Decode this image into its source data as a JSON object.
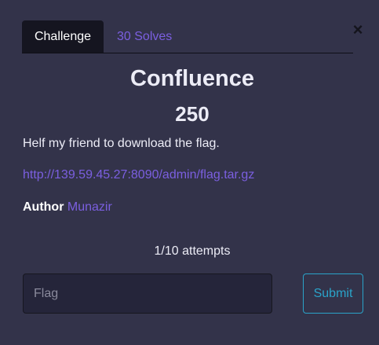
{
  "close": {
    "glyph": "×"
  },
  "tabs": [
    {
      "label": "Challenge",
      "active": true
    },
    {
      "label": "30 Solves",
      "active": false
    }
  ],
  "challenge": {
    "name": "Confluence",
    "points": "250",
    "description": "Helf my friend to download the flag.",
    "link": "http://139.59.45.27:8090/admin/flag.tar.gz",
    "author_label": "Author",
    "author_name": "Munazir"
  },
  "attempts": "1/10 attempts",
  "flag_input": {
    "placeholder": "Flag",
    "value": ""
  },
  "submit_label": "Submit",
  "colors": {
    "background": "#33334a",
    "accent_purple": "#7b5fe0",
    "submit_border": "#2aa3c9",
    "active_tab_bg": "#151520"
  }
}
